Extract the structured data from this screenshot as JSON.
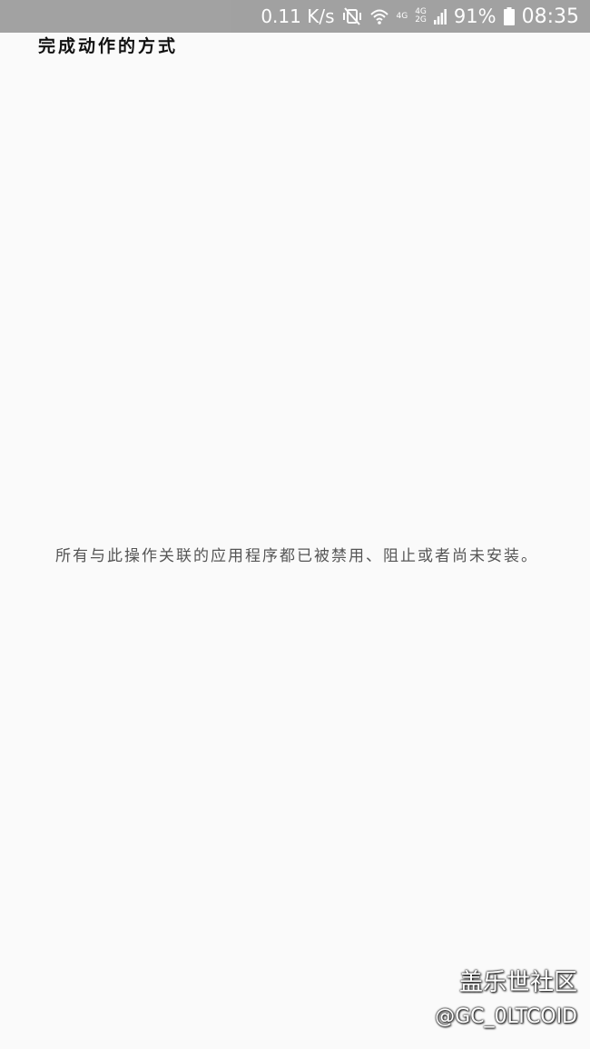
{
  "status_bar": {
    "net_speed": "0.11 K/s",
    "network_a": "4G",
    "network_b_top": "4G",
    "network_b_bottom": "2G",
    "battery": "91%",
    "time": "08:35",
    "icons": [
      "mute-vibrate-icon",
      "wifi-icon",
      "signal-icon",
      "battery-icon"
    ]
  },
  "dialog": {
    "title": "完成动作的方式",
    "message": "所有与此操作关联的应用程序都已被禁用、阻止或者尚未安装。"
  },
  "watermark": {
    "brand": "盖乐世社区",
    "handle": "@GC_0LTCOID"
  }
}
